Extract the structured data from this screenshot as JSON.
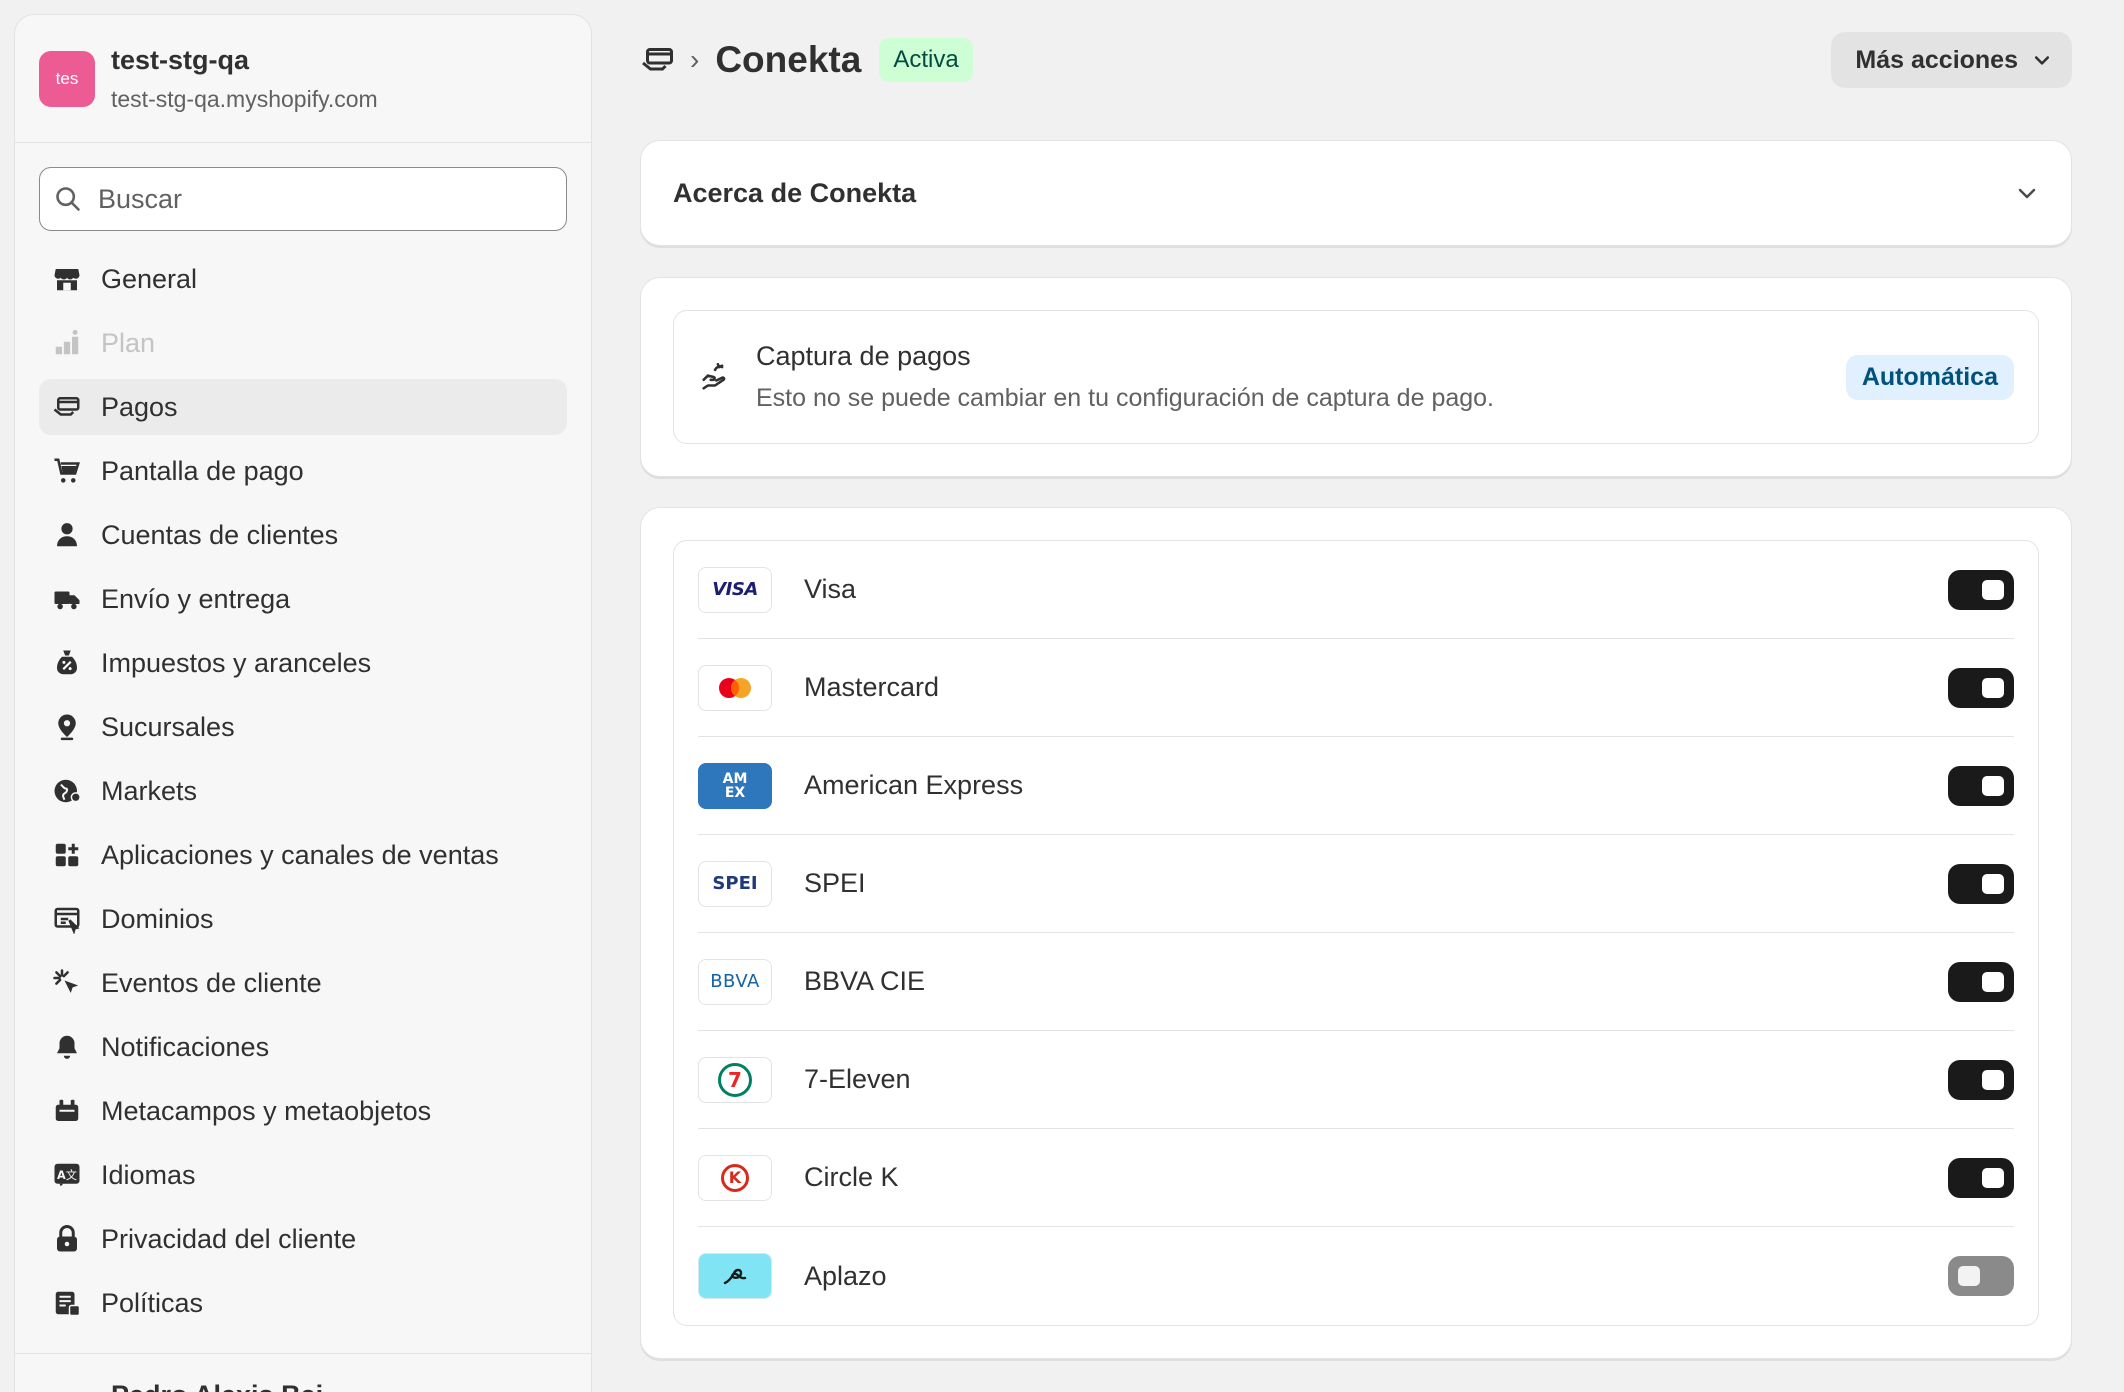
{
  "store": {
    "avatar_text": "tes",
    "name": "test-stg-qa",
    "domain": "test-stg-qa.myshopify.com"
  },
  "search": {
    "placeholder": "Buscar"
  },
  "sidebar": {
    "items": [
      {
        "label": "General",
        "icon": "store-icon"
      },
      {
        "label": "Plan",
        "icon": "plan-icon"
      },
      {
        "label": "Pagos",
        "icon": "payments-icon"
      },
      {
        "label": "Pantalla de pago",
        "icon": "cart-icon"
      },
      {
        "label": "Cuentas de clientes",
        "icon": "person-icon"
      },
      {
        "label": "Envío y entrega",
        "icon": "truck-icon"
      },
      {
        "label": "Impuestos y aranceles",
        "icon": "tax-icon"
      },
      {
        "label": "Sucursales",
        "icon": "location-icon"
      },
      {
        "label": "Markets",
        "icon": "globe-icon"
      },
      {
        "label": "Aplicaciones y canales de ventas",
        "icon": "apps-icon"
      },
      {
        "label": "Dominios",
        "icon": "domains-icon"
      },
      {
        "label": "Eventos de cliente",
        "icon": "cursor-icon"
      },
      {
        "label": "Notificaciones",
        "icon": "bell-icon"
      },
      {
        "label": "Metacampos y metaobjetos",
        "icon": "metafields-icon"
      },
      {
        "label": "Idiomas",
        "icon": "language-icon"
      },
      {
        "label": "Privacidad del cliente",
        "icon": "lock-icon"
      },
      {
        "label": "Políticas",
        "icon": "policy-icon"
      }
    ],
    "active": "Pagos",
    "disabled": "Plan",
    "footer_user": "Pedro Alexis Bai..."
  },
  "header": {
    "title": "Conekta",
    "status": "Activa",
    "more_actions": "Más acciones"
  },
  "about": {
    "title": "Acerca de Conekta"
  },
  "capture": {
    "title": "Captura de pagos",
    "description": "Esto no se puede cambiar en tu configuración de captura de pago.",
    "badge": "Automática"
  },
  "methods": [
    {
      "name": "Visa",
      "logo": "visa-logo",
      "enabled": true
    },
    {
      "name": "Mastercard",
      "logo": "mastercard-logo",
      "enabled": true
    },
    {
      "name": "American Express",
      "logo": "amex-logo",
      "enabled": true
    },
    {
      "name": "SPEI",
      "logo": "spei-logo",
      "enabled": true
    },
    {
      "name": "BBVA CIE",
      "logo": "bbva-logo",
      "enabled": true
    },
    {
      "name": "7-Eleven",
      "logo": "seven-eleven-logo",
      "enabled": true
    },
    {
      "name": "Circle K",
      "logo": "circle-k-logo",
      "enabled": true
    },
    {
      "name": "Aplazo",
      "logo": "aplazo-logo",
      "enabled": false
    }
  ],
  "logo_text": {
    "visa": "VISA",
    "amex": "AM EX",
    "spei": "SPEI",
    "bbva": "BBVA",
    "seven": "7",
    "circlek": "K"
  },
  "colors": {
    "avatar": "#ed5b94",
    "status_badge_bg": "#cdfed4",
    "info_badge_bg": "#e0f0ff",
    "toggle_on": "#1a1a1a",
    "toggle_off": "#8a8a8a"
  }
}
